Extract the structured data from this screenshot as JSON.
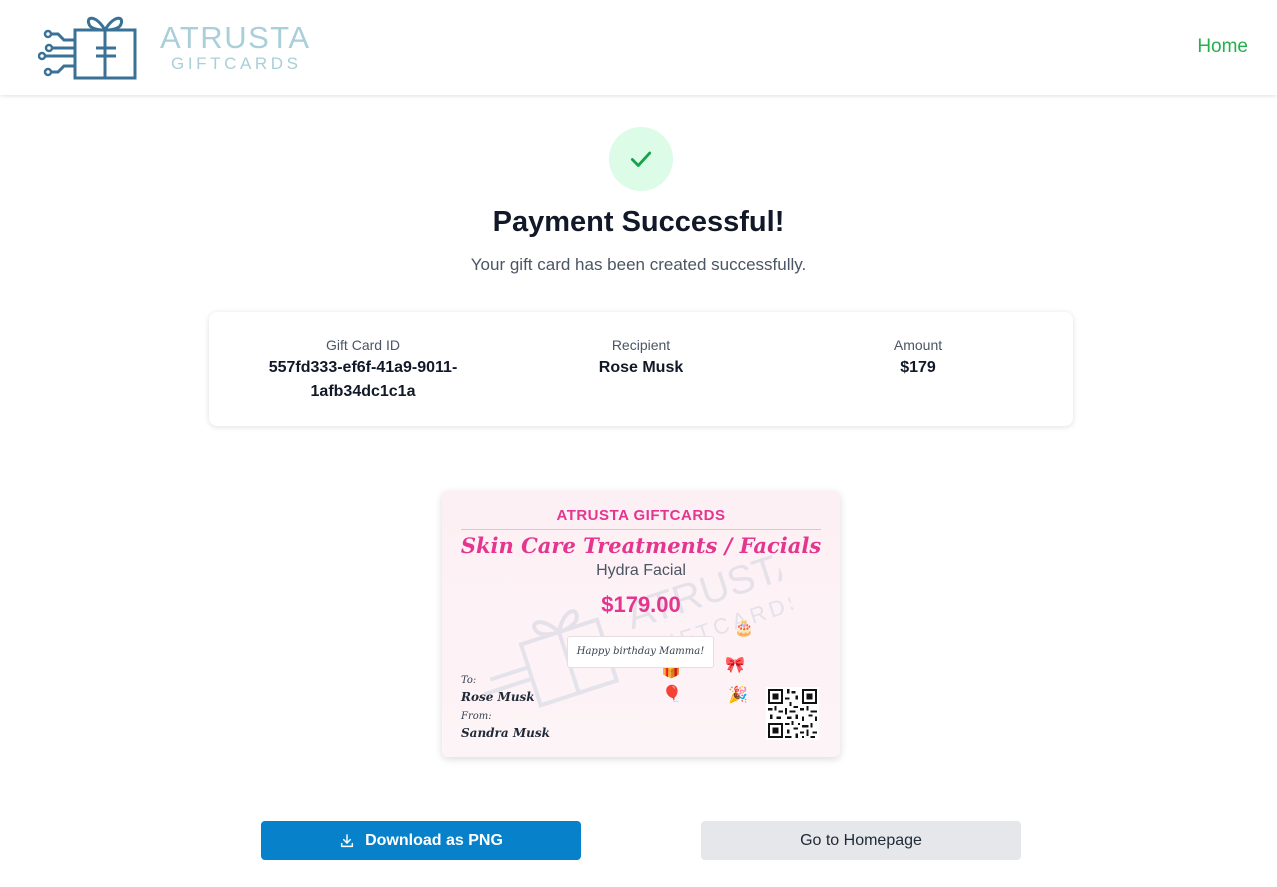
{
  "header": {
    "logo_line1": "ATRUSTA",
    "logo_line2": "GIFTCARDS",
    "nav_home": "Home"
  },
  "success": {
    "title": "Payment Successful!",
    "subtitle": "Your gift card has been created successfully."
  },
  "summary": {
    "id_label": "Gift Card ID",
    "id_line1": "557fd333-ef6f-41a9-9011-",
    "id_line2": "1afb34dc1c1a",
    "recipient_label": "Recipient",
    "recipient_value": "Rose Musk",
    "amount_label": "Amount",
    "amount_value": "$179"
  },
  "gift_card": {
    "brand": "ATRUSTA GIFTCARDS",
    "category": "Skin Care Treatments / Facials",
    "item": "Hydra Facial",
    "amount": "$179.00",
    "message": "Happy birthday Mamma!",
    "to_label": "To:",
    "to": "Rose Musk",
    "from_label": "From:",
    "from": "Sandra Musk",
    "emojis": [
      "🎂",
      "🎁",
      "🎈",
      "🎀",
      "🎉"
    ]
  },
  "actions": {
    "download_label": "Download as PNG",
    "homepage_label": "Go to Homepage"
  },
  "colors": {
    "brand_pink": "#e4358f",
    "nav_green": "#22b14c",
    "primary_blue": "#0782ca",
    "success_bg": "#dcfce7",
    "success_check": "#16a34a"
  }
}
